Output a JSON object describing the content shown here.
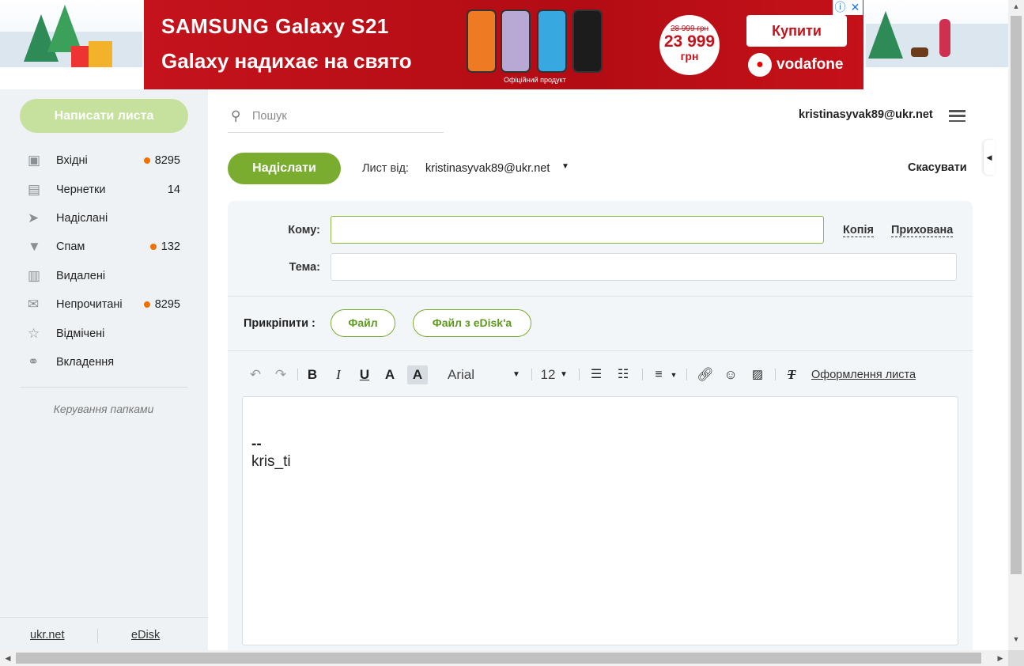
{
  "ad": {
    "line1": "SAMSUNG Galaxy S21",
    "line2": "Galaxy надихає на свято",
    "note": "Офіційний продукт",
    "old_price": "28 999 грн",
    "price": "23 999",
    "currency": "грн",
    "buy_label": "Купити",
    "brand": "vodafone",
    "info_icon": "info-icon",
    "close_icon": "close-icon"
  },
  "sidebar": {
    "compose_label": "Написати листа",
    "folders": [
      {
        "label": "Вхідні",
        "icon": "inbox-icon",
        "count": "8295",
        "dot": true
      },
      {
        "label": "Чернетки",
        "icon": "draft-icon",
        "count": "14",
        "dot": false
      },
      {
        "label": "Надіслані",
        "icon": "sent-icon",
        "count": "",
        "dot": false
      },
      {
        "label": "Спам",
        "icon": "spam-icon",
        "count": "132",
        "dot": true
      },
      {
        "label": "Видалені",
        "icon": "trash-icon",
        "count": "",
        "dot": false
      },
      {
        "label": "Непрочитані",
        "icon": "envelope-icon",
        "count": "8295",
        "dot": true
      },
      {
        "label": "Відмічені",
        "icon": "star-icon",
        "count": "",
        "dot": false
      },
      {
        "label": "Вкладення",
        "icon": "paperclip-icon",
        "count": "",
        "dot": false
      }
    ],
    "manage_label": "Керування папками",
    "footer_links": [
      "ukr.net",
      "eDisk"
    ]
  },
  "header": {
    "search_placeholder": "Пошук",
    "user_email": "kristinasyvak89@ukr.net"
  },
  "compose": {
    "send_label": "Надіслати",
    "from_label": "Лист від:",
    "from_value": "kristinasyvak89@ukr.net",
    "cancel_label": "Скасувати",
    "to_label": "Кому:",
    "to_value": "",
    "cc_label": "Копія",
    "bcc_label": "Прихована",
    "subject_label": "Тема:",
    "subject_value": "",
    "attach_label": "Прикріпити :",
    "file_label": "Файл",
    "edisk_label": "Файл з eDisk'a"
  },
  "editor": {
    "font_name": "Arial",
    "font_size": "12",
    "style_link": "Оформлення листа",
    "body_lines": [
      "--",
      "kris_ti"
    ]
  },
  "colors": {
    "accent_green": "#7aac2f",
    "compose_green": "#c6e09e",
    "badge_orange": "#f07000",
    "ad_red": "#c4131c"
  }
}
